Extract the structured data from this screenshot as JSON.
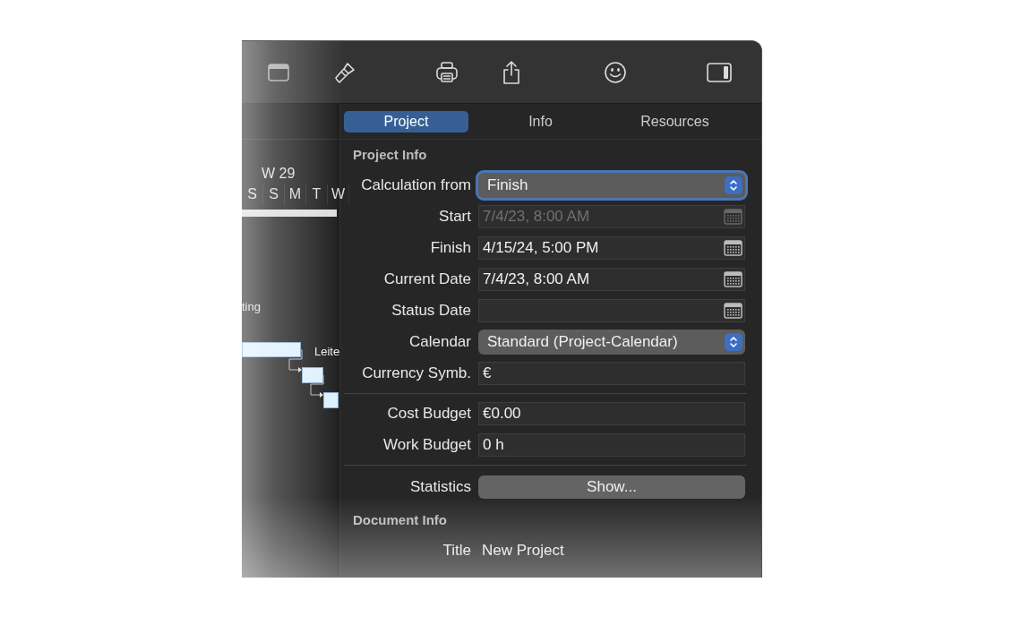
{
  "gantt": {
    "week": "W 29",
    "days": [
      "S",
      "S",
      "M",
      "T",
      "W"
    ],
    "group_label": "ting",
    "task_label": "Leite"
  },
  "tabs": [
    {
      "label": "Project",
      "selected": true
    },
    {
      "label": "Info",
      "selected": false
    },
    {
      "label": "Resources",
      "selected": false
    }
  ],
  "sections": [
    {
      "title": "Project Info",
      "rows": [
        {
          "kind": "popup",
          "label": "Calculation from",
          "value": "Finish",
          "focused": true
        },
        {
          "kind": "date",
          "label": "Start",
          "value": "7/4/23, 8:00 AM",
          "disabled": true
        },
        {
          "kind": "date",
          "label": "Finish",
          "value": "4/15/24, 5:00 PM",
          "disabled": false
        },
        {
          "kind": "date",
          "label": "Current Date",
          "value": "7/4/23, 8:00 AM",
          "disabled": false
        },
        {
          "kind": "date",
          "label": "Status Date",
          "disabled": false
        },
        {
          "kind": "popup",
          "label": "Calendar",
          "value": "Standard (Project-Calendar)",
          "focused": false
        },
        {
          "kind": "text",
          "label": "Currency Symb.",
          "value": "€"
        },
        {
          "kind": "separator"
        },
        {
          "kind": "text",
          "label": "Cost Budget",
          "value": "€0.00"
        },
        {
          "kind": "text",
          "label": "Work Budget",
          "value": "0 h"
        },
        {
          "kind": "separator"
        },
        {
          "kind": "button",
          "label": "Statistics",
          "value": "Show..."
        }
      ]
    },
    {
      "title": "Document Info",
      "rows": [
        {
          "kind": "plain",
          "label": "Title",
          "value": "New Project"
        }
      ]
    }
  ]
}
